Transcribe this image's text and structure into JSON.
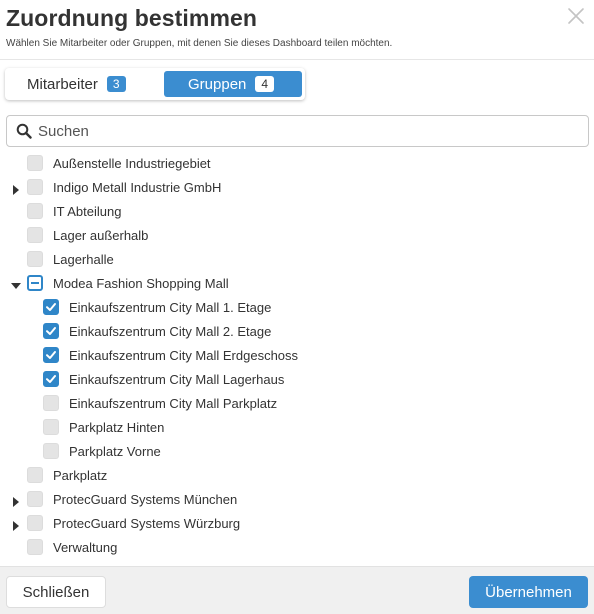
{
  "dialog": {
    "title": "Zuordnung bestimmen",
    "subtitle": "Wählen Sie Mitarbeiter oder Gruppen, mit denen Sie dieses Dashboard teilen möchten.",
    "close_icon": "close-icon"
  },
  "tabs": [
    {
      "label": "Mitarbeiter",
      "count": "3",
      "active": false
    },
    {
      "label": "Gruppen",
      "count": "4",
      "active": true
    }
  ],
  "search": {
    "placeholder": "Suchen",
    "value": "",
    "icon": "search-icon"
  },
  "tree": [
    {
      "label": "Außenstelle Industriegebiet",
      "level": 0,
      "expander": "none",
      "state": "unchecked"
    },
    {
      "label": "Indigo Metall Industrie GmbH",
      "level": 0,
      "expander": "collapsed",
      "state": "unchecked"
    },
    {
      "label": "IT Abteilung",
      "level": 0,
      "expander": "none",
      "state": "unchecked"
    },
    {
      "label": "Lager außerhalb",
      "level": 0,
      "expander": "none",
      "state": "unchecked"
    },
    {
      "label": "Lagerhalle",
      "level": 0,
      "expander": "none",
      "state": "unchecked"
    },
    {
      "label": "Modea Fashion Shopping Mall",
      "level": 0,
      "expander": "expanded",
      "state": "partial"
    },
    {
      "label": "Einkaufszentrum City Mall 1. Etage",
      "level": 1,
      "expander": "none",
      "state": "checked"
    },
    {
      "label": "Einkaufszentrum City Mall 2. Etage",
      "level": 1,
      "expander": "none",
      "state": "checked"
    },
    {
      "label": "Einkaufszentrum City Mall Erdgeschoss",
      "level": 1,
      "expander": "none",
      "state": "checked"
    },
    {
      "label": "Einkaufszentrum City Mall Lagerhaus",
      "level": 1,
      "expander": "none",
      "state": "checked"
    },
    {
      "label": "Einkaufszentrum City Mall Parkplatz",
      "level": 1,
      "expander": "none",
      "state": "unchecked"
    },
    {
      "label": "Parkplatz Hinten",
      "level": 1,
      "expander": "none",
      "state": "unchecked"
    },
    {
      "label": "Parkplatz Vorne",
      "level": 1,
      "expander": "none",
      "state": "unchecked"
    },
    {
      "label": "Parkplatz",
      "level": 0,
      "expander": "none",
      "state": "unchecked"
    },
    {
      "label": "ProtecGuard Systems München",
      "level": 0,
      "expander": "collapsed",
      "state": "unchecked"
    },
    {
      "label": "ProtecGuard Systems Würzburg",
      "level": 0,
      "expander": "collapsed",
      "state": "unchecked"
    },
    {
      "label": "Verwaltung",
      "level": 0,
      "expander": "none",
      "state": "unchecked"
    }
  ],
  "footer": {
    "close_label": "Schließen",
    "apply_label": "Übernehmen"
  },
  "colors": {
    "accent": "#3b8dd0",
    "checkbox_checked": "#2f86c8",
    "checkbox_unchecked": "#e4e4e4",
    "footer_bg": "#f0f0f0"
  }
}
